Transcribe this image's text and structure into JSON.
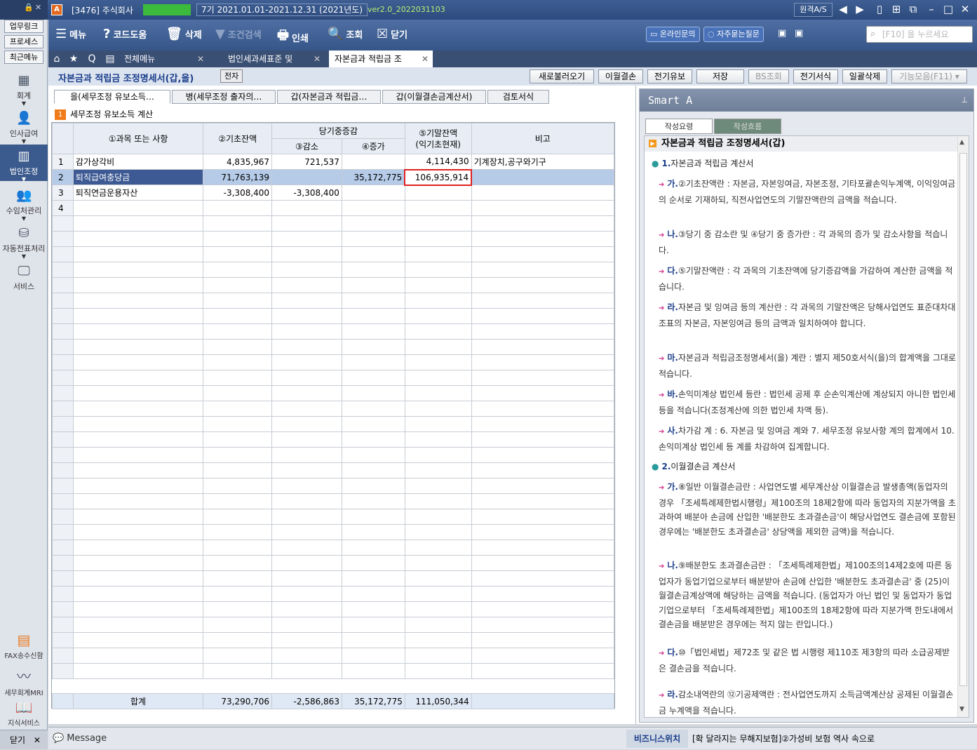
{
  "titlebar": {
    "company": "[3476] 주식회사",
    "period": "7기  2021.01.01-2021.12.31  (2021년도)",
    "version": "ver2.0_2022031103",
    "remote": "원격A/S",
    "lock_icon": "lock-icon"
  },
  "leftnav": {
    "quick": [
      "업무링크",
      "프로세스",
      "최근메뉴"
    ],
    "items": [
      {
        "label": "회계",
        "icon": "calculator-icon"
      },
      {
        "label": "인사급여",
        "icon": "person-icon"
      },
      {
        "label": "법인조정",
        "icon": "building-icon"
      },
      {
        "label": "수임처관리",
        "icon": "people-icon"
      },
      {
        "label": "자동전표처리",
        "icon": "database-icon"
      },
      {
        "label": "서비스",
        "icon": "monitor-icon"
      }
    ],
    "bottom": [
      {
        "label": "FAX송수신함",
        "icon": "fax-icon"
      },
      {
        "label": "세무회계MRI",
        "icon": "pulse-icon"
      },
      {
        "label": "지식서비스",
        "icon": "book-icon"
      }
    ],
    "close_label": "닫기"
  },
  "toolbar": {
    "menu": "메뉴",
    "code_help": "코드도움",
    "delete": "삭제",
    "cond_search": "조건검색",
    "print": "인쇄",
    "query": "조회",
    "close": "닫기",
    "online_inquiry": "온라인문의",
    "faq": "자주묻는질문",
    "search_placeholder": "[F10] 을 누르세요"
  },
  "tabs": {
    "all_menu": "전체메뉴",
    "tab1": "법인세과세표준 및",
    "tab2": "자본금과 적립금 조"
  },
  "header": {
    "title": "자본금과 적립금 조정명세서(갑,을)",
    "badge": "전자",
    "buttons": [
      "새로불러오기",
      "이월결손",
      "전기유보",
      "저장",
      "BS조회",
      "전기서식",
      "일괄삭제",
      "기능모음(F11)"
    ]
  },
  "subtabs": [
    "을(세무조정 유보소득…",
    "병(세무조정 출자의…",
    "갑(자본금과 적립금…",
    "갑(이월결손금계산서)",
    "검토서식"
  ],
  "section": {
    "num": "1",
    "title": "세무조정 유보소득 계산"
  },
  "grid": {
    "headers": {
      "subject": "①과목 또는 사항",
      "opening": "②기초잔액",
      "change": "당기중증감",
      "decrease": "③감소",
      "increase": "④증가",
      "closing_l1": "⑤기말잔액",
      "closing_l2": "(익기초현재)",
      "remark": "비고"
    },
    "rows": [
      {
        "no": "1",
        "subject": "감가상각비",
        "opening": "4,835,967",
        "decrease": "721,537",
        "increase": "",
        "closing": "4,114,430",
        "remark": "기계장치,공구와기구"
      },
      {
        "no": "2",
        "subject": "퇴직급여충당금",
        "opening": "71,763,139",
        "decrease": "",
        "increase": "35,172,775",
        "closing": "106,935,914",
        "remark": ""
      },
      {
        "no": "3",
        "subject": "퇴직연금운용자산",
        "opening": "-3,308,400",
        "decrease": "-3,308,400",
        "increase": "",
        "closing": "",
        "remark": ""
      },
      {
        "no": "4",
        "subject": "",
        "opening": "",
        "decrease": "",
        "increase": "",
        "closing": "",
        "remark": ""
      }
    ],
    "total": {
      "label": "합계",
      "opening": "73,290,706",
      "decrease": "-2,586,863",
      "increase": "35,172,775",
      "closing": "111,050,344"
    }
  },
  "smart": {
    "title": "Smart A",
    "tab_a": "작성요령",
    "tab_b": "작성흐름",
    "heading": "자본금과 적립금 조정명세서(갑)",
    "sec1_num": "1.",
    "sec1": "자본금과 적립금 계산서",
    "sec2_num": "2.",
    "sec2": "이월결손금 계산서",
    "items1": [
      {
        "k": "가.",
        "t": "②기초잔액란 : 자본금, 자본잉여금, 자본조정, 기타포괄손익누계액, 이익잉여금의 순서로 기재하되, 직전사업연도의 기말잔액란의 금액을 적습니다."
      },
      {
        "k": "나.",
        "t": "③당기 중 감소란 및 ④당기 중 증가란 : 각 과목의 증가 및 감소사항을 적습니다."
      },
      {
        "k": "다.",
        "t": "⑤기말잔액란 : 각 과목의 기초잔액에 당기증감액을 가감하여 계산한 금액을 적습니다."
      },
      {
        "k": "라.",
        "t": "자본금 및 잉여금 등의 계산란 : 각 과목의 기말잔액은 당해사업연도 표준대차대조표의 자본금, 자본잉여금 등의 금액과 일치하여야 합니다."
      },
      {
        "k": "마.",
        "t": "자본금과 적립금조정명세서(을) 계란 : 별지 제50호서식(을)의 합계액을 그대로 적습니다."
      },
      {
        "k": "바.",
        "t": "손익미계상 법인세 등란 : 법인세 공제 후 순손익계산에 계상되지 아니한 법인세등을 적습니다(조정계산에 의한 법인세 차액 등)."
      },
      {
        "k": "사.",
        "t": "차가감 계 : 6. 자본금 및 잉여금 계와 7. 세무조정 유보사항 계의 합계에서 10. 손익미계상 법인세 등 계를 차감하여 집계합니다."
      }
    ],
    "items2": [
      {
        "k": "가.",
        "t": "⑧일반 이월결손금란 : 사업연도별 세무계산상 이월결손금 발생총액(동업자의 경우 「조세특례제한법시행령」제100조의 18제2항에 따라 동업자의 지분가액을 초과하여 배분아 손금에 산입한 '배분한도 초과결손금'이 해당사업연도 결손금에 포함된 경우에는 '배분한도 초과결손금' 상당액을 제외한 금액)을 적습니다."
      },
      {
        "k": "나.",
        "t": "⑨배분한도 초과결손금란 : 「조세특례제한법」제100조의14제2호에 따른 동업자가 동업기업으로부터 배분받아 손금에 산입한 '배분한도 초과결손금' 중 (25)이월결손금계상액에 해당하는 금액을 적습니다. (동업자가 아닌 법인 및 동업자가 동업기업으로부터 「조세특례제한법」제100조의 18제2항에 따라 지분가액 한도내에서 결손금을 배분받은 경우에는 적지 않는 란입니다.)"
      },
      {
        "k": "다.",
        "t": "⑩「법인세법」제72조 및 같은 법 시행령 제110조 제3항의 따라 소급공제받은 결손금을 적습니다."
      },
      {
        "k": "라.",
        "t": "감소내역란의 ⑫기공제액란 : 전사업연도까지 소득금액계산상 공제된 이월결손금 누계액을 적습니다."
      }
    ]
  },
  "statusbar": {
    "message": "Message",
    "biz": "비즈니스위치",
    "news": "[확 달라지는 무해지보험]②가성비 보험 역사 속으로"
  }
}
